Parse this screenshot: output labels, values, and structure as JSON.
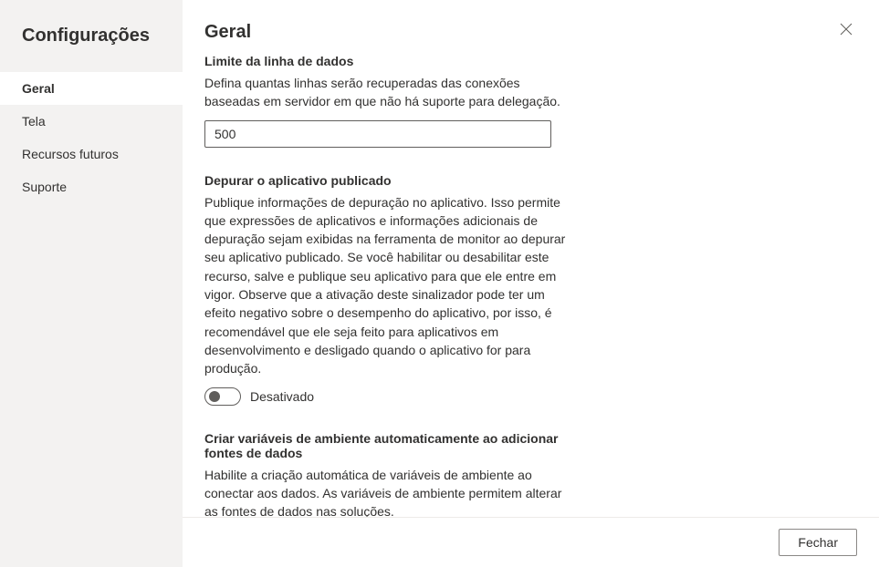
{
  "sidebar": {
    "title": "Configurações",
    "items": [
      {
        "label": "Geral",
        "active": true
      },
      {
        "label": "Tela",
        "active": false
      },
      {
        "label": "Recursos futuros",
        "active": false
      },
      {
        "label": "Suporte",
        "active": false
      }
    ]
  },
  "header": {
    "title": "Geral"
  },
  "sections": {
    "dataRowLimit": {
      "title": "Limite da linha de dados",
      "desc": "Defina quantas linhas serão recuperadas das conexões baseadas em servidor em que não há suporte para delegação.",
      "value": "500"
    },
    "debugPublished": {
      "title": "Depurar o aplicativo publicado",
      "desc": "Publique informações de depuração no aplicativo. Isso permite que expressões de aplicativos e informações adicionais de depuração sejam exibidas na ferramenta de monitor ao depurar seu aplicativo publicado. Se você habilitar ou desabilitar este recurso, salve e publique seu aplicativo para que ele entre em vigor. Observe que a ativação deste sinalizador pode ter um efeito negativo sobre o desempenho do aplicativo, por isso, é recomendável que ele seja feito para aplicativos em desenvolvimento e desligado quando o aplicativo for para produção.",
      "toggleLabel": "Desativado",
      "toggleState": false
    },
    "autoEnvVars": {
      "title": "Criar variáveis de ambiente automaticamente ao adicionar fontes de dados",
      "desc": "Habilite a criação automática de variáveis de ambiente ao conectar aos dados. As variáveis de ambiente permitem alterar as fontes de dados nas soluções."
    }
  },
  "footer": {
    "closeLabel": "Fechar"
  }
}
